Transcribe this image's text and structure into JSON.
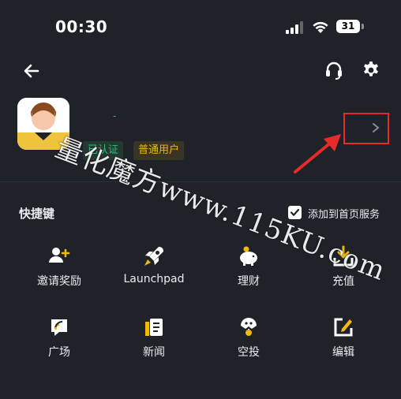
{
  "status_bar": {
    "time": "00:30",
    "battery": "31"
  },
  "header": {
    "back_icon": "back-arrow-icon",
    "support_icon": "headset-icon",
    "settings_icon": "gear-icon"
  },
  "profile": {
    "name_mark": "-",
    "badge_verified": "已认证",
    "badge_user_type": "普通用户"
  },
  "shortcuts": {
    "title": "快捷键",
    "add_to_home_label": "添加到首页服务",
    "add_to_home_checked": true,
    "items": [
      {
        "label": "邀请奖励",
        "icon": "add-user-icon"
      },
      {
        "label": "Launchpad",
        "icon": "rocket-icon"
      },
      {
        "label": "理财",
        "icon": "piggy-bank-icon"
      },
      {
        "label": "充值",
        "icon": "download-icon"
      },
      {
        "label": "广场",
        "icon": "square-feed-icon"
      },
      {
        "label": "新闻",
        "icon": "news-icon"
      },
      {
        "label": "空投",
        "icon": "airdrop-icon"
      },
      {
        "label": "编辑",
        "icon": "edit-icon"
      }
    ]
  },
  "watermark": "量化魔方www.115KU.com",
  "colors": {
    "background": "#1f2329",
    "accent": "#f0b90b",
    "verified_green": "#2ebd85",
    "annotation_red": "#e62b2b"
  }
}
